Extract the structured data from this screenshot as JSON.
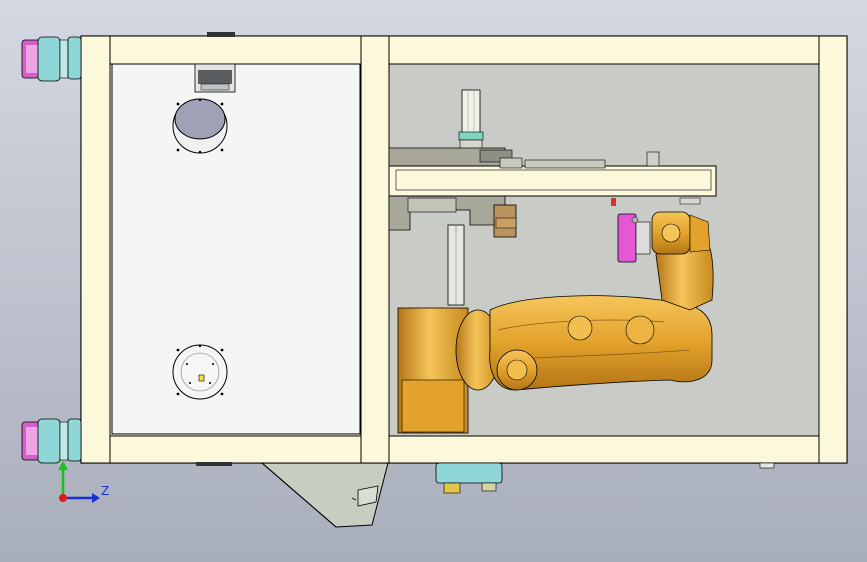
{
  "viewport": {
    "background_top": "#d4d8e2",
    "background_bottom": "#a9aebb"
  },
  "colors": {
    "frame_fill": "#fbf8dc",
    "frame_stroke": "#000000",
    "cabinet_bay": "#c9cbc6",
    "steel_panel": "#f4f5f5",
    "robot_gold": "#e3a22c",
    "robot_gold_dark": "#b47516",
    "robot_gold_light": "#f5c55a",
    "caster_cyan": "#8fd6d6",
    "caster_magenta": "#d35fc8",
    "gripper_magenta": "#e657d6",
    "bracket_gray": "#a8a89a",
    "bracket_brown": "#b9925c",
    "tray_gray": "#c6cbbe"
  },
  "triad": {
    "axis_label": "Z",
    "y_axis_color": "#19c019",
    "z_axis_color": "#1a2fd6",
    "origin_color": "#e01919"
  }
}
